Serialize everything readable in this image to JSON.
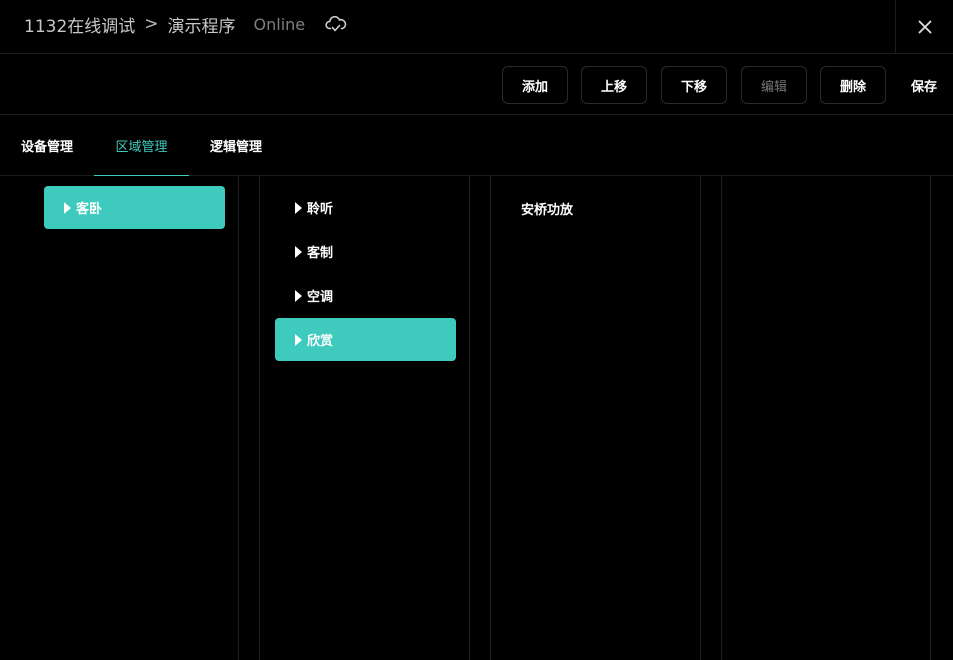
{
  "header": {
    "project": "1132在线调试",
    "separator": ">",
    "program": "演示程序",
    "status": "Online",
    "cloud_icon": "cloud-sync-icon",
    "close_icon": "close-icon"
  },
  "toolbar": {
    "add": "添加",
    "move_up": "上移",
    "move_down": "下移",
    "edit": "编辑",
    "delete": "删除",
    "save": "保存"
  },
  "tabs": [
    {
      "label": "设备管理",
      "active": false
    },
    {
      "label": "区域管理",
      "active": true
    },
    {
      "label": "逻辑管理",
      "active": false
    }
  ],
  "columns": {
    "rooms": [
      {
        "label": "客卧",
        "selected": true
      }
    ],
    "groups": [
      {
        "label": "聆听",
        "selected": false
      },
      {
        "label": "客制",
        "selected": false
      },
      {
        "label": "空调",
        "selected": false
      },
      {
        "label": "欣赏",
        "selected": true
      }
    ],
    "devices": [
      {
        "label": "安桥功放"
      }
    ]
  },
  "colors": {
    "accent": "#3ecbbd",
    "background": "#000000",
    "border": "#2a2a2a"
  }
}
